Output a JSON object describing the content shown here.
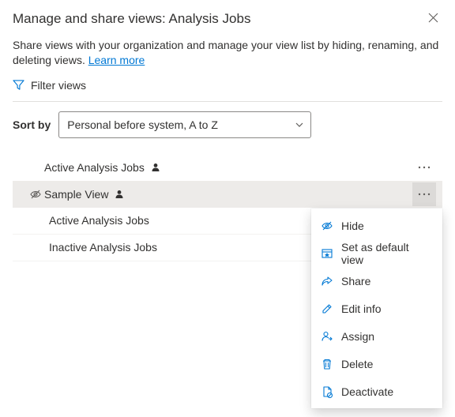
{
  "header": {
    "title": "Manage and share views: Analysis Jobs",
    "description_prefix": "Share views with your organization and manage your view list by hiding, renaming, and deleting views. ",
    "learn_more": "Learn more"
  },
  "filter": {
    "label": "Filter views"
  },
  "sort": {
    "label": "Sort by",
    "selected": "Personal before system, A to Z"
  },
  "views": [
    {
      "label": "Active Analysis Jobs",
      "personal": true,
      "hidden": false,
      "selected": false,
      "hasMore": true
    },
    {
      "label": "Sample View",
      "personal": true,
      "hidden": true,
      "selected": true,
      "hasMore": true
    },
    {
      "label": "Active Analysis Jobs",
      "personal": false,
      "hidden": false,
      "selected": false,
      "hasMore": false
    },
    {
      "label": "Inactive Analysis Jobs",
      "personal": false,
      "hidden": false,
      "selected": false,
      "hasMore": false
    }
  ],
  "contextMenu": {
    "items": [
      {
        "icon": "hide-icon",
        "label": "Hide"
      },
      {
        "icon": "default-icon",
        "label": "Set as default view"
      },
      {
        "icon": "share-icon",
        "label": "Share"
      },
      {
        "icon": "edit-icon",
        "label": "Edit info"
      },
      {
        "icon": "assign-icon",
        "label": "Assign"
      },
      {
        "icon": "delete-icon",
        "label": "Delete"
      },
      {
        "icon": "deactivate-icon",
        "label": "Deactivate"
      }
    ]
  }
}
